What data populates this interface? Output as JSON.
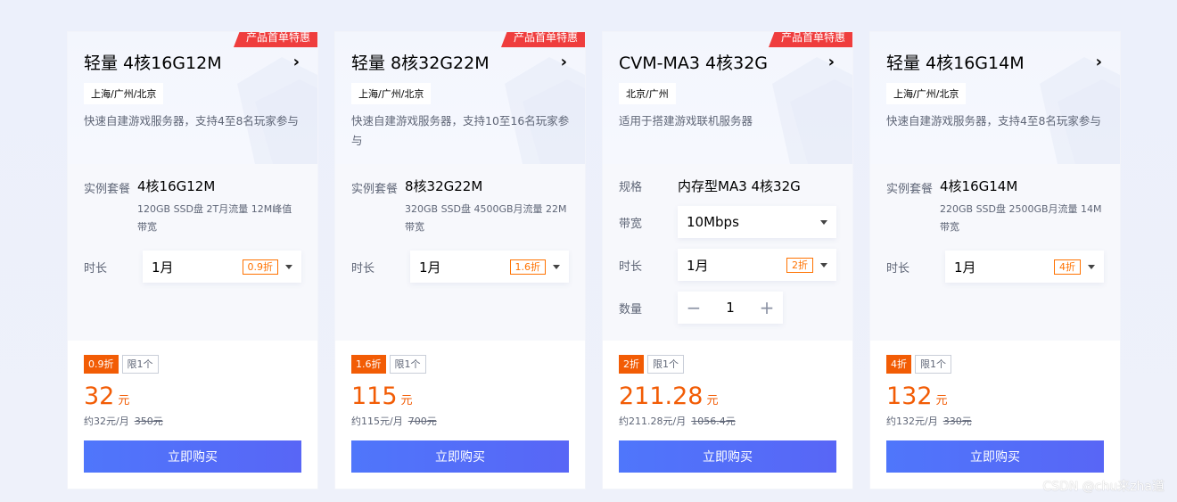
{
  "cards": [
    {
      "ribbon": "产品首单特惠",
      "title": "轻量 4核16G12M",
      "region": "上海/广州/北京",
      "desc": "快速自建游戏服务器，支持4至8名玩家参与",
      "spec_label": "实例套餐",
      "spec_main": "4核16G12M",
      "spec_sub": "120GB SSD盘 2T月流量 12M峰值带宽",
      "duration_label": "时长",
      "duration_value": "1月",
      "duration_discount": "0.9折",
      "tag_discount": "0.9折",
      "tag_limit": "限1个",
      "price": "32",
      "price_unit": "元",
      "per_month": "约32元/月",
      "original": "350元",
      "buy_label": "立即购买"
    },
    {
      "ribbon": "产品首单特惠",
      "title": "轻量 8核32G22M",
      "region": "上海/广州/北京",
      "desc": "快速自建游戏服务器，支持10至16名玩家参与",
      "spec_label": "实例套餐",
      "spec_main": "8核32G22M",
      "spec_sub": "320GB SSD盘 4500GB月流量 22M带宽",
      "duration_label": "时长",
      "duration_value": "1月",
      "duration_discount": "1.6折",
      "tag_discount": "1.6折",
      "tag_limit": "限1个",
      "price": "115",
      "price_unit": "元",
      "per_month": "约115元/月",
      "original": "700元",
      "buy_label": "立即购买"
    },
    {
      "ribbon": "产品首单特惠",
      "title": "CVM-MA3 4核32G",
      "region": "北京/广州",
      "desc": "适用于搭建游戏联机服务器",
      "spec_label": "规格",
      "spec_main": "内存型MA3 4核32G",
      "bandwidth_label": "带宽",
      "bandwidth_value": "10Mbps",
      "duration_label": "时长",
      "duration_value": "1月",
      "duration_discount": "2折",
      "qty_label": "数量",
      "qty_minus": "−",
      "qty_value": "1",
      "qty_plus": "+",
      "tag_discount": "2折",
      "tag_limit": "限1个",
      "price": "211.28",
      "price_unit": "元",
      "per_month": "约211.28元/月",
      "original": "1056.4元",
      "buy_label": "立即购买"
    },
    {
      "ribbon": "",
      "title": "轻量 4核16G14M",
      "region": "上海/广州/北京",
      "desc": "快速自建游戏服务器，支持4至8名玩家参与",
      "spec_label": "实例套餐",
      "spec_main": "4核16G14M",
      "spec_sub": "220GB SSD盘 2500GB月流量 14M带宽",
      "duration_label": "时长",
      "duration_value": "1月",
      "duration_discount": "4折",
      "tag_discount": "4折",
      "tag_limit": "限1个",
      "price": "132",
      "price_unit": "元",
      "per_month": "约132元/月",
      "original": "330元",
      "buy_label": "立即购买"
    }
  ],
  "icons": {
    "chevron": "chevron-right-icon",
    "dropdown": "caret-down-icon"
  },
  "colors": {
    "accent": "#f25c05",
    "ribbon": "#ef3d3d",
    "button": "#4f76fb"
  },
  "watermark": "CSDN @chu来zha道"
}
